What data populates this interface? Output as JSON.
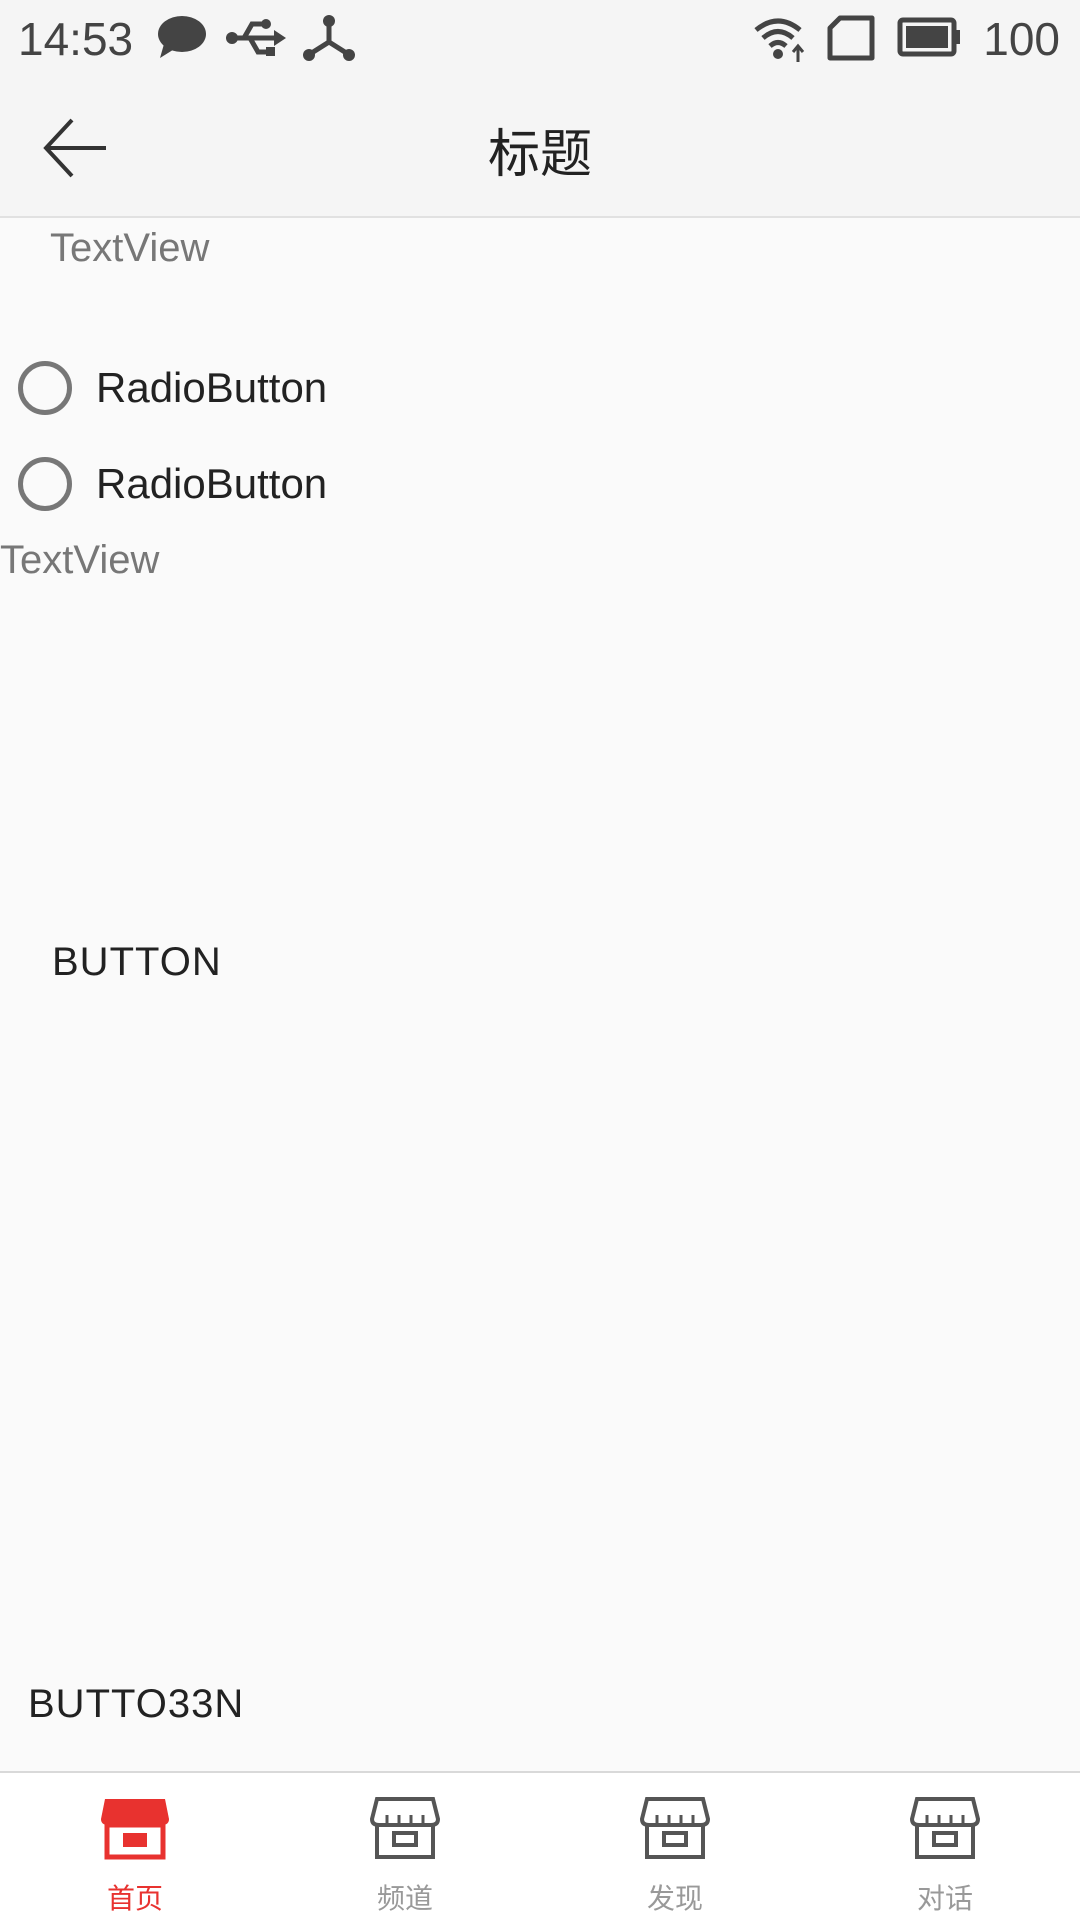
{
  "status_bar": {
    "time": "14:53",
    "battery": "100",
    "icons": [
      "chat-icon",
      "usb-icon",
      "share-hub-icon",
      "wifi-icon",
      "sim-icon",
      "battery-icon"
    ]
  },
  "title_bar": {
    "title": "标题",
    "back_icon": "arrow-left-icon"
  },
  "content": {
    "text_view_1": "TextView",
    "radio_1": "RadioButton",
    "radio_2": "RadioButton",
    "text_view_2": "TextView",
    "button_1": "BUTTON",
    "button_2": "BUTTO33N"
  },
  "bottom_nav": {
    "items": [
      {
        "label": "首页",
        "icon": "store-icon",
        "active": true
      },
      {
        "label": "频道",
        "icon": "store-icon",
        "active": false
      },
      {
        "label": "发现",
        "icon": "store-icon",
        "active": false
      },
      {
        "label": "对话",
        "icon": "store-icon",
        "active": false
      }
    ]
  },
  "colors": {
    "accent": "#e8322f",
    "inactive": "#999999",
    "background": "#fafafa"
  }
}
